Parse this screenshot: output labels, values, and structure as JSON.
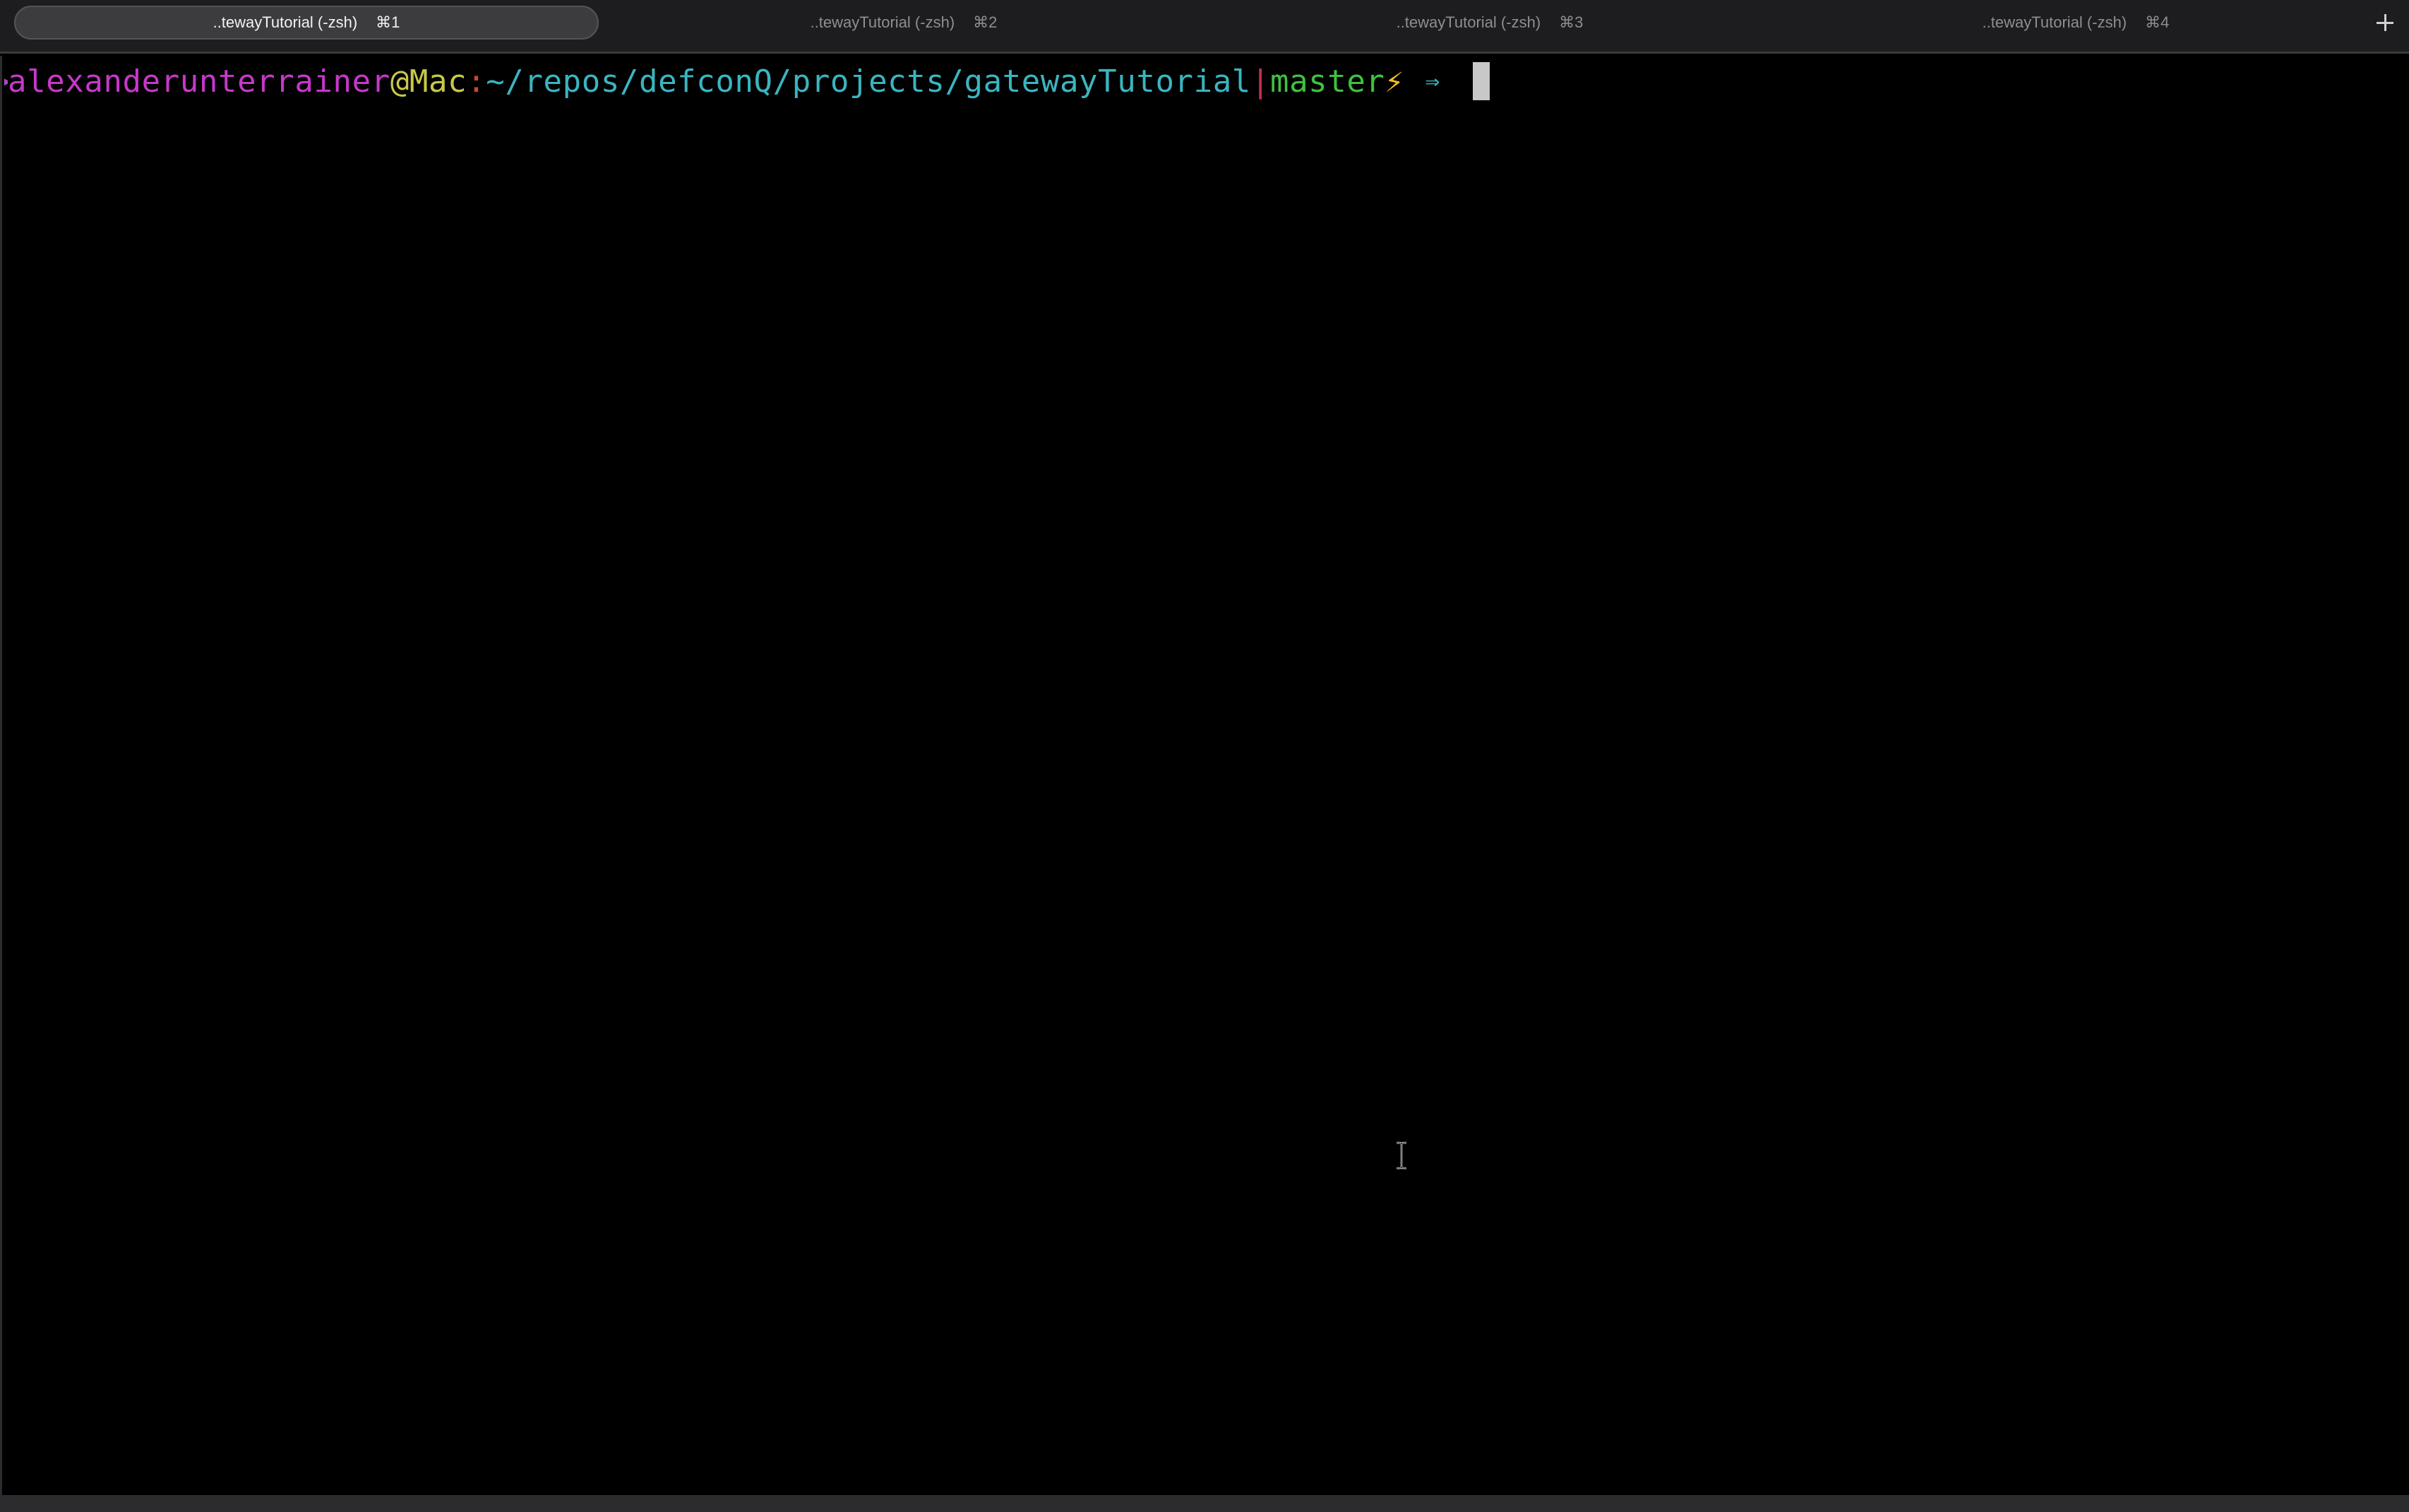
{
  "tabs": [
    {
      "title": "..tewayTutorial (-zsh)",
      "shortcut": "⌘1",
      "active": true
    },
    {
      "title": "..tewayTutorial (-zsh)",
      "shortcut": "⌘2",
      "active": false
    },
    {
      "title": "..tewayTutorial (-zsh)",
      "shortcut": "⌘3",
      "active": false
    },
    {
      "title": "..tewayTutorial (-zsh)",
      "shortcut": "⌘4",
      "active": false
    }
  ],
  "new_tab_icon": "plus-icon",
  "prompt": {
    "user": "alexanderunterrainer",
    "at": "@",
    "host": "Mac",
    "colon": ":",
    "path": "~/repos/defconQ/projects/gatewayTutorial",
    "separator": "|",
    "branch": "master",
    "bolt": "⚡",
    "arrow": "⇒"
  },
  "colors": {
    "background": "#000000",
    "user": "#c638c9",
    "host": "#c8c84a",
    "path": "#3ab5c0",
    "branch": "#40c040",
    "bolt": "#f0c020"
  },
  "mouse_cursor_icon": "ibeam-icon"
}
